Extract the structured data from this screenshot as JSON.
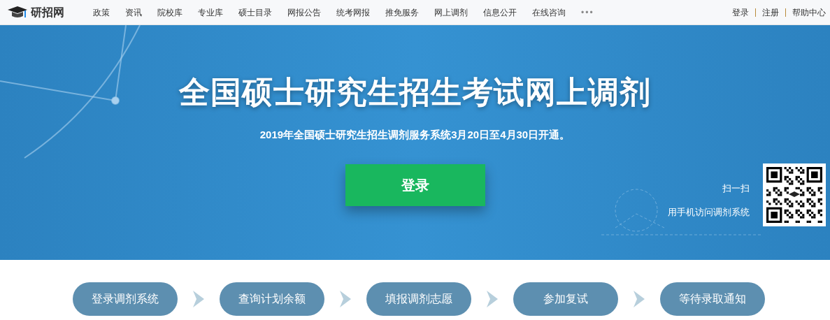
{
  "header": {
    "logo": "研招网",
    "nav": [
      "政策",
      "资讯",
      "院校库",
      "专业库",
      "硕士目录",
      "网报公告",
      "统考网报",
      "推免服务",
      "网上调剂",
      "信息公开",
      "在线咨询"
    ],
    "more": "•••",
    "links": [
      "登录",
      "注册",
      "帮助中心"
    ]
  },
  "hero": {
    "title": "全国硕士研究生招生考试网上调剂",
    "subtitle": "2019年全国硕士研究生招生调剂服务系统3月20日至4月30日开通。",
    "login_button": "登录",
    "scan_title": "扫一扫",
    "scan_hint": "用手机访问调剂系统"
  },
  "steps": [
    "登录调剂系统",
    "查询计划余额",
    "填报调剂志愿",
    "参加复试",
    "等待录取通知"
  ]
}
